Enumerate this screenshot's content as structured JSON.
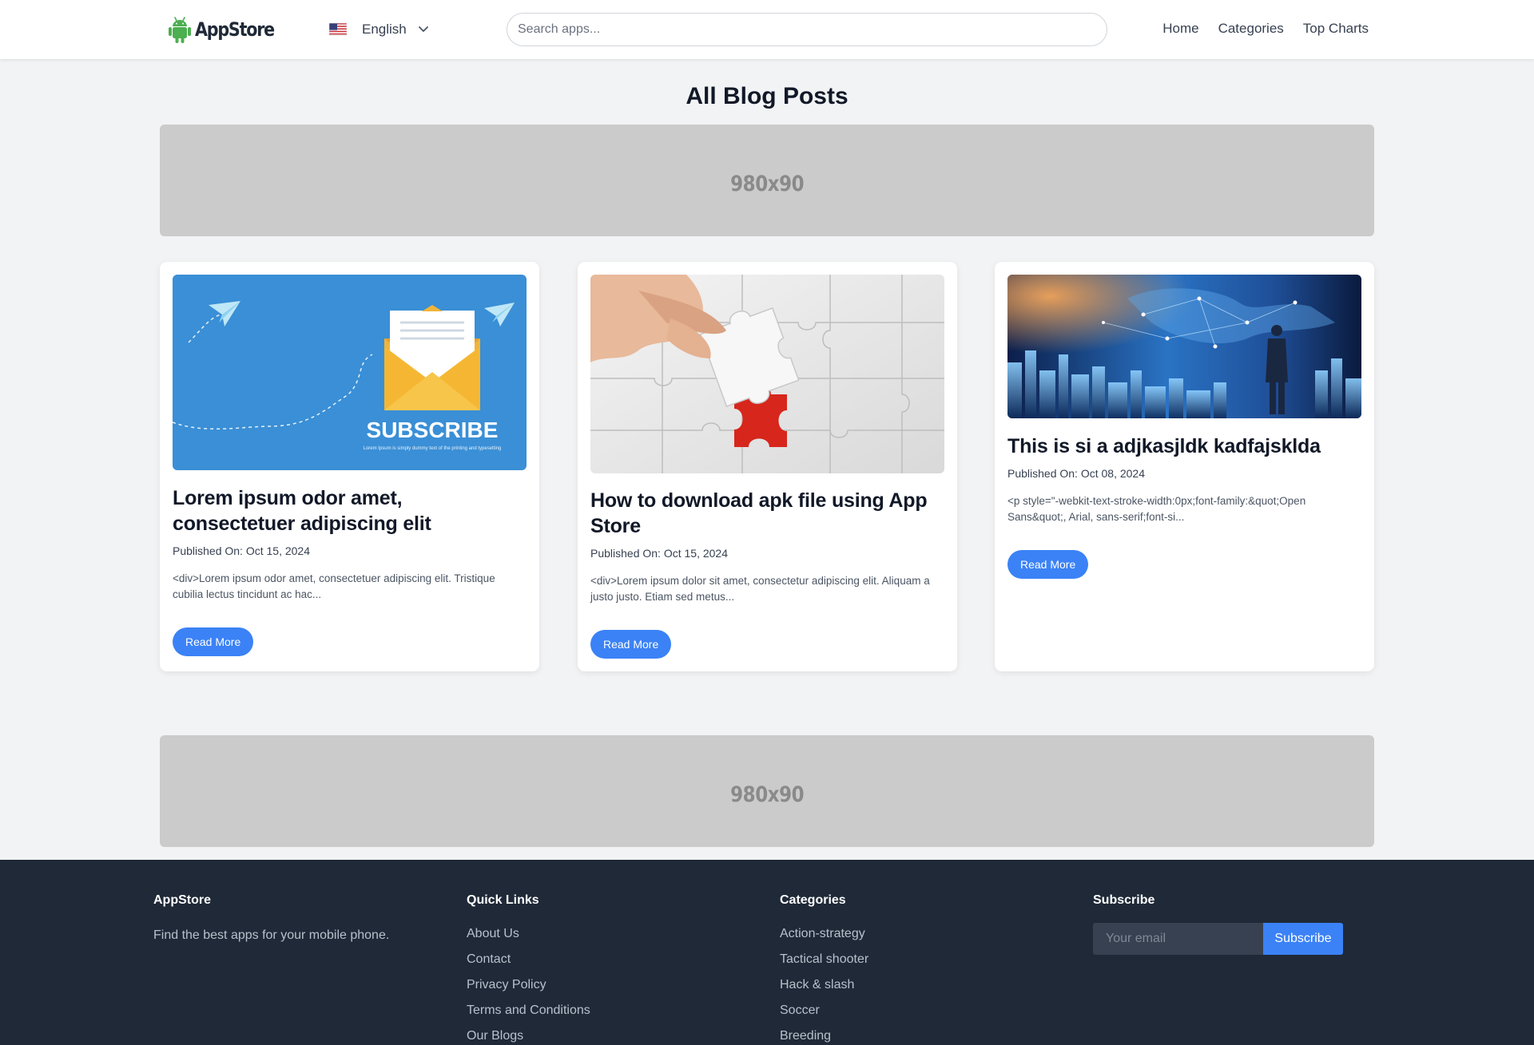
{
  "header": {
    "logo_text": "AppStore",
    "language": "English",
    "search_placeholder": "Search apps...",
    "nav": [
      "Home",
      "Categories",
      "Top Charts"
    ]
  },
  "page": {
    "title": "All Blog Posts"
  },
  "ads": {
    "top_label": "980x90",
    "bottom_label": "980x90"
  },
  "posts": [
    {
      "title": "Lorem ipsum odor amet, consectetuer adipiscing elit",
      "date": "Published On: Oct 15, 2024",
      "excerpt": "<div>Lorem ipsum odor amet, consectetuer adipiscing elit. Tristique cubilia lectus tincidunt ac hac...",
      "button": "Read More",
      "image": {
        "heading": "SUBSCRIBE",
        "subtext": "Lorem Ipsum is simply dummy text of the printing and typesetting"
      }
    },
    {
      "title": "How to download apk file using App Store",
      "date": "Published On: Oct 15, 2024",
      "excerpt": "<div>Lorem ipsum dolor sit amet, consectetur adipiscing elit. Aliquam a justo justo. Etiam sed metus...",
      "button": "Read More"
    },
    {
      "title": "This is si a adjkasjldk kadfajsklda",
      "date": "Published On: Oct 08, 2024",
      "excerpt": "<p style=\"-webkit-text-stroke-width:0px;font-family:&quot;Open Sans&quot;, Arial, sans-serif;font-si...",
      "button": "Read More"
    }
  ],
  "footer": {
    "about": {
      "heading": "AppStore",
      "text": "Find the best apps for your mobile phone."
    },
    "quick_links": {
      "heading": "Quick Links",
      "items": [
        "About Us",
        "Contact",
        "Privacy Policy",
        "Terms and Conditions",
        "Our Blogs"
      ]
    },
    "categories": {
      "heading": "Categories",
      "items": [
        "Action-strategy",
        "Tactical shooter",
        "Hack & slash",
        "Soccer",
        "Breeding"
      ]
    },
    "subscribe": {
      "heading": "Subscribe",
      "placeholder": "Your email",
      "button": "Subscribe"
    }
  },
  "colors": {
    "accent": "#3b82f6",
    "footer_bg": "#1f2937",
    "page_bg": "#f2f3f5",
    "ad_bg": "#cbcbcb",
    "logo_green": "#4caf50"
  },
  "icons": {
    "logo": "android-robot-icon",
    "language": "us-flag-icon",
    "language_toggle": "chevron-down-icon"
  }
}
